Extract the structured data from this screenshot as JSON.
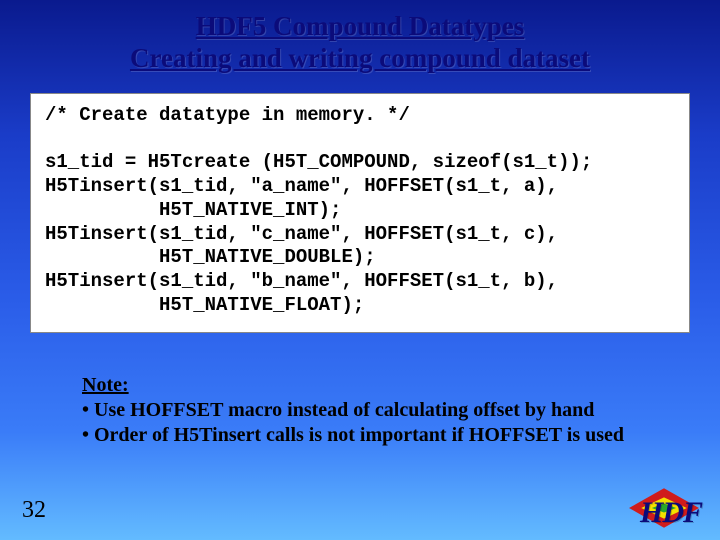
{
  "title": {
    "line1": "HDF5 Compound Datatypes",
    "line2": "Creating and writing compound dataset"
  },
  "code": {
    "comment": "/* Create datatype in memory. */",
    "l1": "s1_tid = H5Tcreate (H5T_COMPOUND, sizeof(s1_t));",
    "l2": "H5Tinsert(s1_tid, \"a_name\", HOFFSET(s1_t, a),",
    "l3": "          H5T_NATIVE_INT);",
    "l4": "H5Tinsert(s1_tid, \"c_name\", HOFFSET(s1_t, c),",
    "l5": "          H5T_NATIVE_DOUBLE);",
    "l6": "H5Tinsert(s1_tid, \"b_name\", HOFFSET(s1_t, b),",
    "l7": "          H5T_NATIVE_FLOAT);"
  },
  "note": {
    "heading": "Note:",
    "b1": "• Use HOFFSET macro instead of calculating offset by hand",
    "b2": "• Order of H5Tinsert calls is not important if HOFFSET is used"
  },
  "page_number": "32",
  "logo_text": "HDF"
}
